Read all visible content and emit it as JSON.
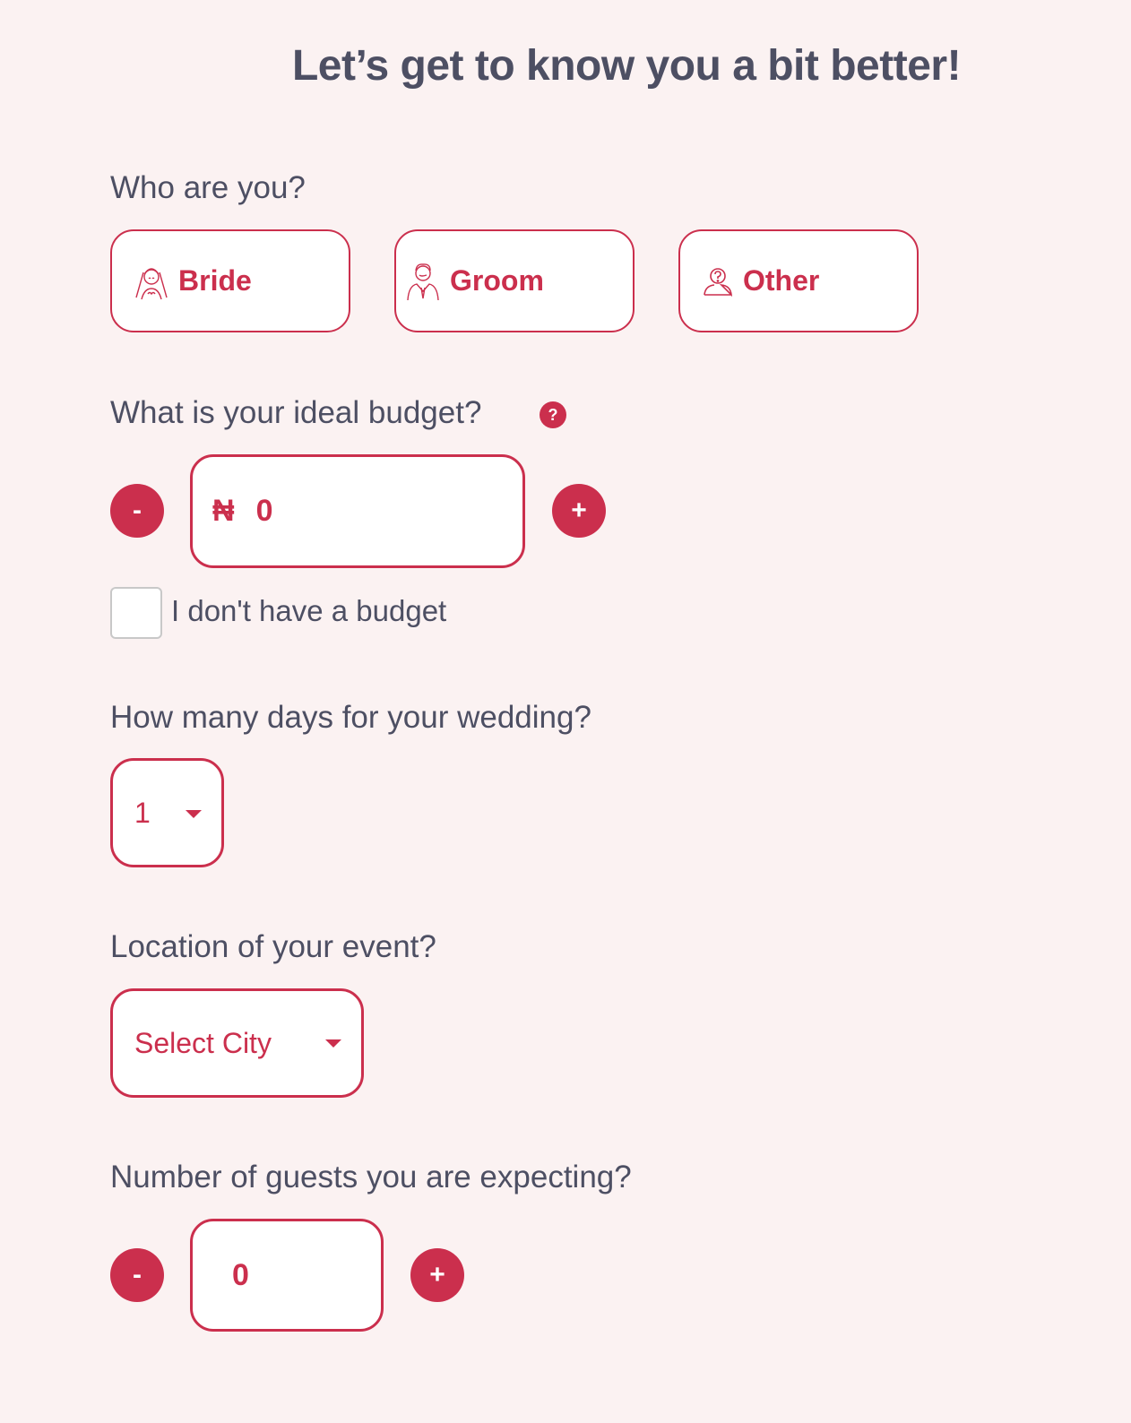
{
  "page": {
    "title": "Let’s get to know you a bit better!",
    "accent_color": "#cb2f4d",
    "text_color": "#4d4f63",
    "background_color": "#fbf2f2"
  },
  "who": {
    "label": "Who are you?",
    "options": [
      {
        "label": "Bride",
        "icon": "bride-icon"
      },
      {
        "label": "Groom",
        "icon": "groom-icon"
      },
      {
        "label": "Other",
        "icon": "person-question-icon"
      }
    ]
  },
  "budget": {
    "label": "What is your ideal budget?",
    "help_icon": "?",
    "currency_symbol": "₦",
    "value": "0",
    "minus_label": "-",
    "plus_label": "+",
    "no_budget_label": "I don't have a budget",
    "no_budget_checked": false
  },
  "days": {
    "label": "How many days for your wedding?",
    "selected": "1"
  },
  "location": {
    "label": "Location of your event?",
    "placeholder": "Select City"
  },
  "guests": {
    "label": "Number of guests you are expecting?",
    "value": "0",
    "minus_label": "-",
    "plus_label": "+"
  }
}
